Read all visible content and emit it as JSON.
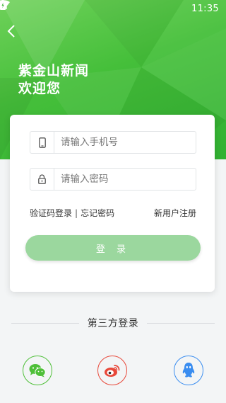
{
  "status_bar": {
    "time": "11:35"
  },
  "header": {
    "title_line1": "紫金山新闻",
    "title_line2": "欢迎您"
  },
  "form": {
    "phone_placeholder": "请输入手机号",
    "password_placeholder": "请输入密码",
    "sms_login_label": "验证码登录",
    "separator": "|",
    "forgot_password_label": "忘记密码",
    "register_label": "新用户注册",
    "login_button_label": "登 录"
  },
  "third_party": {
    "title": "第三方登录",
    "providers": [
      "wechat-icon",
      "weibo-icon",
      "qq-icon"
    ]
  },
  "colors": {
    "brand_green": "#45bf3a",
    "login_button": "#9bd79e",
    "wechat": "#4ebf38",
    "weibo": "#e8483a",
    "qq": "#3a8df0"
  },
  "icons": {
    "status": [
      "wifi-icon",
      "no-sim-icon",
      "battery-charging-icon"
    ],
    "back": "back-arrow-icon",
    "phone_field": "mobile-phone-icon",
    "password_field": "lock-icon"
  }
}
